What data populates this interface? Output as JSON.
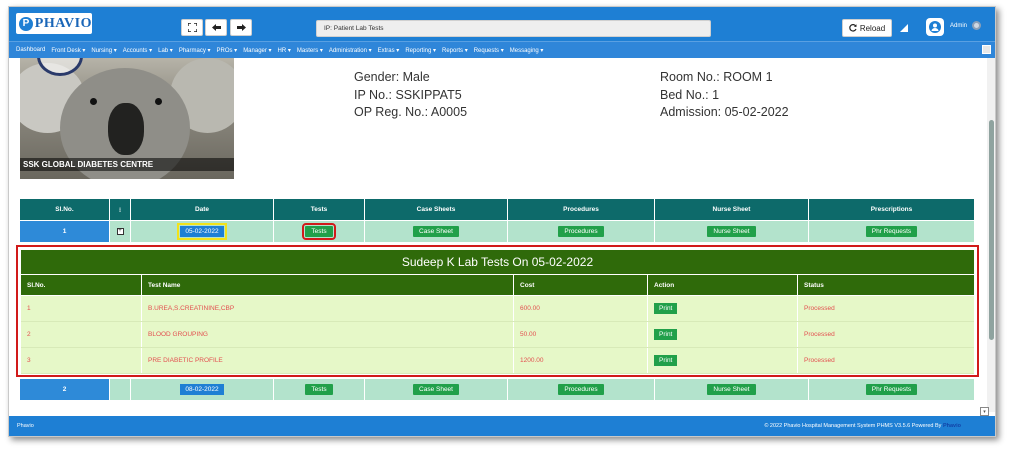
{
  "app": {
    "logo_text": "PHAVIO",
    "logo_mark": "P",
    "search_value": "IP: Patient Lab Tests",
    "reload_label": "Reload",
    "admin_label": "Admin"
  },
  "menu": [
    "Dashboard",
    "Front Desk ▾",
    "Nursing ▾",
    "Accounts ▾",
    "Lab ▾",
    "Pharmacy ▾",
    "PROs ▾",
    "Manager ▾",
    "HR ▾",
    "Masters ▾",
    "Administration ▾",
    "Extras ▾",
    "Reporting ▾",
    "Reports ▾",
    "Requests ▾",
    "Messaging ▾"
  ],
  "patient": {
    "photo_caption": "SSK GLOBAL DIABETES CENTRE",
    "gender": "Gender: Male",
    "ip_no": "IP No.: SSKIPPAT5",
    "op_reg": "OP Reg. No.: A0005",
    "room": "Room No.: ROOM 1",
    "bed": "Bed No.: 1",
    "admission": "Admission: 05-02-2022"
  },
  "admissions_table": {
    "headers": [
      "Sl.No.",
      "⁝",
      "Date",
      "Tests",
      "Case Sheets",
      "Procedures",
      "Nurse Sheet",
      "Prescriptions"
    ],
    "rows": [
      {
        "sl": "1",
        "expand": "+",
        "date": "05-02-2022",
        "tests": "Tests",
        "case": "Case Sheet",
        "proc": "Procedures",
        "nurse": "Nurse Sheet",
        "presc": "Phr Requests"
      },
      {
        "sl": "2",
        "expand": "",
        "date": "08-02-2022",
        "tests": "Tests",
        "case": "Case Sheet",
        "proc": "Procedures",
        "nurse": "Nurse Sheet",
        "presc": "Phr Requests"
      }
    ]
  },
  "lab_tests": {
    "title": "Sudeep K Lab Tests On 05-02-2022",
    "headers": [
      "Sl.No.",
      "Test Name",
      "Cost",
      "Action",
      "Status"
    ],
    "rows": [
      {
        "sl": "1",
        "name": "B.UREA,S.CREATININE,CBP",
        "cost": "600.00",
        "action": "Print",
        "status": "Processed"
      },
      {
        "sl": "2",
        "name": "BLOOD GROUPING",
        "cost": "50.00",
        "action": "Print",
        "status": "Processed"
      },
      {
        "sl": "3",
        "name": "PRE DIABETIC PROFILE",
        "cost": "1200.00",
        "action": "Print",
        "status": "Processed"
      }
    ]
  },
  "footer": {
    "left": "Phavio",
    "right": "© 2022 Phavio Hospital Management System PHMS V3.5.6 Powered By",
    "brand": "Phavio"
  },
  "colors": {
    "topbar": "#1e7fd4",
    "table_header": "#0d6a6a",
    "lab_header": "#2f6a0a",
    "button_green": "#21a04a"
  }
}
